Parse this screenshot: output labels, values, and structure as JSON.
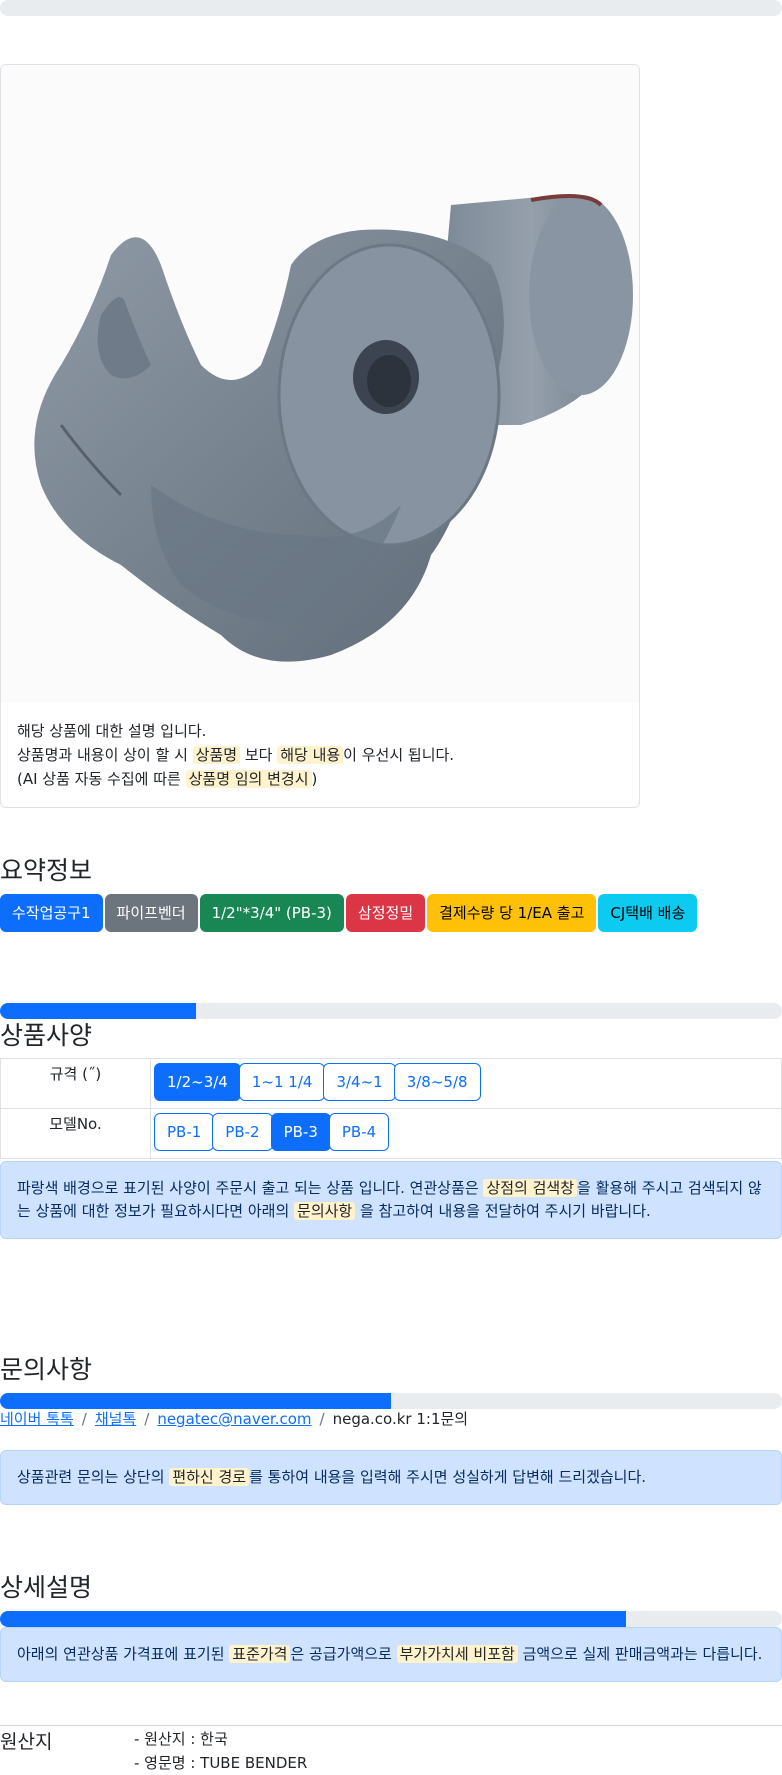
{
  "progress": {
    "top_bar": 0,
    "spec_bar": 25,
    "inquiry_bar": 50,
    "detail_bar": 80
  },
  "product": {
    "image_alt": "파이프벤더 PB-3 제품 이미지",
    "desc_line1": "해당 상품에 대한 설명 입니다.",
    "desc_line2_a": "상품명과 내용이 상이 할 시 ",
    "desc_line2_mark1": "상품명",
    "desc_line2_b": " 보다 ",
    "desc_line2_mark2": "해당 내용",
    "desc_line2_c": "이 우선시 됩니다.",
    "desc_line3_a": "(AI 상품 자동 수집에 따른 ",
    "desc_line3_mark": "상품명 임의 변경시",
    "desc_line3_b": ")"
  },
  "summary": {
    "title": "요약정보",
    "badges": [
      {
        "label": "수작업공구1",
        "color": "#0d6efd"
      },
      {
        "label": "파이프벤더",
        "color": "#6c757d"
      },
      {
        "label": "1/2\"*3/4\" (PB-3)",
        "color": "#198754"
      },
      {
        "label": "삼정정밀",
        "color": "#dc3545"
      },
      {
        "label": "결제수량 당 1/EA 출고",
        "color": "#ffc107"
      },
      {
        "label": "CJ택배 배송",
        "color": "#0dcaf0"
      }
    ]
  },
  "spec": {
    "title": "상품사양",
    "rows": [
      {
        "label": "규격 (˝)",
        "options": [
          "1/2~3/4",
          "1~1 1/4",
          "3/4~1",
          "3/8~5/8"
        ],
        "selected": 0
      },
      {
        "label": "모델No.",
        "options": [
          "PB-1",
          "PB-2",
          "PB-3",
          "PB-4"
        ],
        "selected": 2
      }
    ],
    "notice_a": "파랑색 배경으로 표기된 사양이 주문시 출고 되는 상품 입니다. 연관상품은 ",
    "notice_mark1": "상점의 검색창",
    "notice_b": "을 활용해 주시고 검색되지 않는 상품에 대한 정보가 필요하시다면 아래의 ",
    "notice_mark2": "문의사항",
    "notice_c": " 을 참고하여 내용을 전달하여 주시기 바랍니다."
  },
  "inquiry": {
    "title": "문의사항",
    "links": [
      "네이버 톡톡",
      "채널톡",
      "negatec@naver.com"
    ],
    "plain": "nega.co.kr 1:1문의",
    "sep": "/",
    "notice_a": "상품관련 문의는 상단의 ",
    "notice_mark": "편하신 경로",
    "notice_b": "를 통하여 내용을 입력해 주시면 성실하게 답변해 드리겠습니다."
  },
  "detail": {
    "title": "상세설명",
    "notice_a": "아래의 연관상품 가격표에 표기된 ",
    "notice_mark1": "표준가격",
    "notice_b": "은 공급가액으로 ",
    "notice_mark2": "부가가치세 비포함",
    "notice_c": " 금액으로 실제 판매금액과는 다릅니다."
  },
  "origin": {
    "label": "원산지",
    "items": [
      "- 원산지 : 한국",
      "- 영문명 : TUBE BENDER"
    ]
  }
}
